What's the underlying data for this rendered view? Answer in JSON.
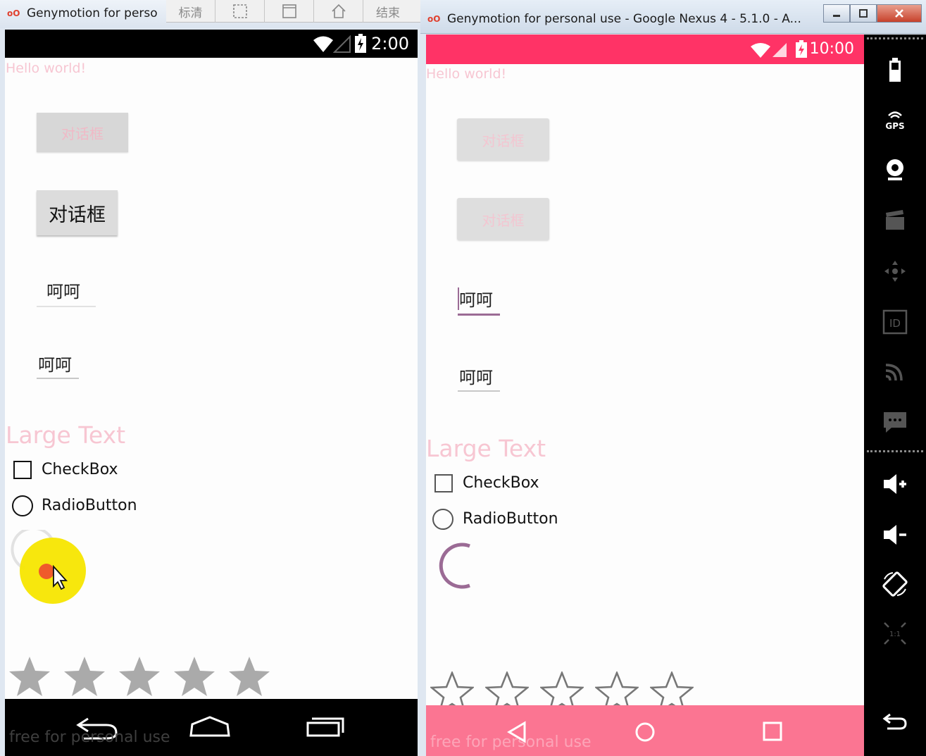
{
  "left_window": {
    "title": "Genymotion for perso",
    "toolbar": [
      {
        "label": "标清",
        "icon": ""
      },
      {
        "label": "",
        "icon": "select-region-icon"
      },
      {
        "label": "",
        "icon": "window-icon"
      },
      {
        "label": "",
        "icon": "home-house-icon"
      },
      {
        "label": "结束",
        "icon": ""
      }
    ],
    "status_time": "2:00",
    "hello": "Hello world!",
    "button_disabled": "对话框",
    "button_normal": "对话框",
    "edit_text_1": "呵呵",
    "edit_text_2": "呵呵",
    "large_text": "Large Text",
    "checkbox": "CheckBox",
    "radio": "RadioButton",
    "watermark": "free for personal use",
    "rating": 0
  },
  "right_window": {
    "title": "Genymotion for personal use - Google Nexus 4 - 5.1.0 - A...",
    "status_time": "10:00",
    "hello": "Hello world!",
    "button_disabled_1": "对话框",
    "button_disabled_2": "对话框",
    "edit_text_1": "呵呵",
    "edit_text_2": "呵呵",
    "large_text": "Large Text",
    "checkbox": "CheckBox",
    "radio": "RadioButton",
    "watermark": "free for personal use",
    "rating": 0
  },
  "side_panel": {
    "gps_label": "GPS",
    "id_label": "ID",
    "scale_label": "1:1",
    "icons": [
      "battery-icon",
      "gps-icon",
      "webcam-icon",
      "video-capture-icon",
      "dpad-icon",
      "id-icon",
      "cast-icon",
      "sms-icon",
      "volume-up-icon",
      "volume-down-icon",
      "rotate-icon",
      "pixel-perfect-icon",
      "back-icon"
    ]
  },
  "colors": {
    "accent_pink": "#ff3366",
    "nav_pink": "#fb7592",
    "hint_pink": "#f7c6d2",
    "spinner_purple": "#9b6b95"
  }
}
